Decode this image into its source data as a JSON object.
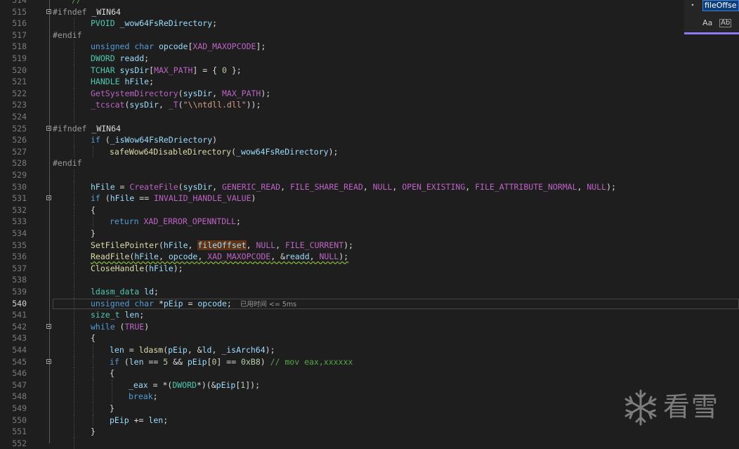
{
  "find_widget": {
    "search_value": "fileOffse",
    "toggle_icon": "chevron-right-icon",
    "match_case_label": "Aa",
    "whole_word_label": "Ab"
  },
  "watermark": {
    "icon": "snowflake-icon",
    "text": "看雪"
  },
  "editor": {
    "current_line": 540,
    "lines": [
      {
        "n": "514",
        "indent": 1,
        "fold": false,
        "tokens": [
          {
            "t": "//",
            "c": "cm"
          }
        ]
      },
      {
        "n": "515",
        "indent": 0,
        "fold": true,
        "tokens": [
          {
            "t": "#ifndef ",
            "c": "pp"
          },
          {
            "t": "_WIN64",
            "c": "plain"
          }
        ]
      },
      {
        "n": "516",
        "indent": 2,
        "fold": false,
        "tokens": [
          {
            "t": "PVOID ",
            "c": "ty"
          },
          {
            "t": "_wow64FsReDirectory",
            "c": "var"
          },
          {
            "t": ";",
            "c": "plain"
          }
        ]
      },
      {
        "n": "517",
        "indent": 0,
        "fold": false,
        "tokens": [
          {
            "t": "#endif",
            "c": "pp"
          }
        ]
      },
      {
        "n": "518",
        "indent": 2,
        "fold": false,
        "tokens": [
          {
            "t": "unsigned ",
            "c": "kw"
          },
          {
            "t": "char ",
            "c": "kw"
          },
          {
            "t": "opcode",
            "c": "var"
          },
          {
            "t": "[",
            "c": "plain"
          },
          {
            "t": "XAD_MAXOPCODE",
            "c": "mac"
          },
          {
            "t": "];",
            "c": "plain"
          }
        ]
      },
      {
        "n": "519",
        "indent": 2,
        "fold": false,
        "tokens": [
          {
            "t": "DWORD ",
            "c": "ty"
          },
          {
            "t": "readd",
            "c": "var"
          },
          {
            "t": ";",
            "c": "plain"
          }
        ]
      },
      {
        "n": "520",
        "indent": 2,
        "fold": false,
        "tokens": [
          {
            "t": "TCHAR ",
            "c": "ty"
          },
          {
            "t": "sysDir",
            "c": "var"
          },
          {
            "t": "[",
            "c": "plain"
          },
          {
            "t": "MAX_PATH",
            "c": "mac"
          },
          {
            "t": "] = { ",
            "c": "plain"
          },
          {
            "t": "0",
            "c": "num"
          },
          {
            "t": " };",
            "c": "plain"
          }
        ]
      },
      {
        "n": "521",
        "indent": 2,
        "fold": false,
        "tokens": [
          {
            "t": "HANDLE ",
            "c": "ty"
          },
          {
            "t": "hFile",
            "c": "var"
          },
          {
            "t": ";",
            "c": "plain"
          }
        ]
      },
      {
        "n": "522",
        "indent": 2,
        "fold": false,
        "tokens": [
          {
            "t": "GetSystemDirectory",
            "c": "mac"
          },
          {
            "t": "(",
            "c": "plain"
          },
          {
            "t": "sysDir",
            "c": "var"
          },
          {
            "t": ", ",
            "c": "plain"
          },
          {
            "t": "MAX_PATH",
            "c": "mac"
          },
          {
            "t": ");",
            "c": "plain"
          }
        ]
      },
      {
        "n": "523",
        "indent": 2,
        "fold": false,
        "tokens": [
          {
            "t": "_tcscat",
            "c": "mac"
          },
          {
            "t": "(",
            "c": "plain"
          },
          {
            "t": "sysDir",
            "c": "var"
          },
          {
            "t": ", ",
            "c": "plain"
          },
          {
            "t": "_T",
            "c": "mac"
          },
          {
            "t": "(",
            "c": "plain"
          },
          {
            "t": "\"\\\\ntdll.dll\"",
            "c": "str"
          },
          {
            "t": "));",
            "c": "plain"
          }
        ]
      },
      {
        "n": "524",
        "indent": 2,
        "fold": false,
        "tokens": []
      },
      {
        "n": "525",
        "indent": 0,
        "fold": true,
        "tokens": [
          {
            "t": "#ifndef ",
            "c": "pp"
          },
          {
            "t": "_WIN64",
            "c": "plain"
          }
        ]
      },
      {
        "n": "526",
        "indent": 2,
        "fold": false,
        "tokens": [
          {
            "t": "if ",
            "c": "kw"
          },
          {
            "t": "(",
            "c": "plain"
          },
          {
            "t": "_isWow64FsReDriectory",
            "c": "var"
          },
          {
            "t": ")",
            "c": "plain"
          }
        ]
      },
      {
        "n": "527",
        "indent": 3,
        "fold": false,
        "tokens": [
          {
            "t": "safeWow64DisableDirectory",
            "c": "fn"
          },
          {
            "t": "(",
            "c": "plain"
          },
          {
            "t": "_wow64FsReDirectory",
            "c": "var"
          },
          {
            "t": ");",
            "c": "plain"
          }
        ]
      },
      {
        "n": "528",
        "indent": 0,
        "fold": false,
        "tokens": [
          {
            "t": "#endif",
            "c": "pp"
          }
        ]
      },
      {
        "n": "529",
        "indent": 2,
        "fold": false,
        "tokens": []
      },
      {
        "n": "530",
        "indent": 2,
        "fold": false,
        "tokens": [
          {
            "t": "hFile",
            "c": "var"
          },
          {
            "t": " = ",
            "c": "plain"
          },
          {
            "t": "CreateFile",
            "c": "mac"
          },
          {
            "t": "(",
            "c": "plain"
          },
          {
            "t": "sysDir",
            "c": "var"
          },
          {
            "t": ", ",
            "c": "plain"
          },
          {
            "t": "GENERIC_READ",
            "c": "mac"
          },
          {
            "t": ", ",
            "c": "plain"
          },
          {
            "t": "FILE_SHARE_READ",
            "c": "mac"
          },
          {
            "t": ", ",
            "c": "plain"
          },
          {
            "t": "NULL",
            "c": "mac"
          },
          {
            "t": ", ",
            "c": "plain"
          },
          {
            "t": "OPEN_EXISTING",
            "c": "mac"
          },
          {
            "t": ", ",
            "c": "plain"
          },
          {
            "t": "FILE_ATTRIBUTE_NORMAL",
            "c": "mac"
          },
          {
            "t": ", ",
            "c": "plain"
          },
          {
            "t": "NULL",
            "c": "mac"
          },
          {
            "t": ");",
            "c": "plain"
          }
        ]
      },
      {
        "n": "531",
        "indent": 2,
        "fold": true,
        "tokens": [
          {
            "t": "if ",
            "c": "kw"
          },
          {
            "t": "(",
            "c": "plain"
          },
          {
            "t": "hFile",
            "c": "var"
          },
          {
            "t": " == ",
            "c": "plain"
          },
          {
            "t": "INVALID_HANDLE_VALUE",
            "c": "mac"
          },
          {
            "t": ")",
            "c": "plain"
          }
        ]
      },
      {
        "n": "532",
        "indent": 2,
        "fold": false,
        "tokens": [
          {
            "t": "{",
            "c": "plain"
          }
        ]
      },
      {
        "n": "533",
        "indent": 3,
        "fold": false,
        "tokens": [
          {
            "t": "return ",
            "c": "kw"
          },
          {
            "t": "XAD_ERROR_OPENNTDLL",
            "c": "mac"
          },
          {
            "t": ";",
            "c": "plain"
          }
        ]
      },
      {
        "n": "534",
        "indent": 2,
        "fold": false,
        "tokens": [
          {
            "t": "}",
            "c": "plain"
          }
        ]
      },
      {
        "n": "535",
        "indent": 2,
        "fold": false,
        "tokens": [
          {
            "t": "SetFilePointer",
            "c": "fn"
          },
          {
            "t": "(",
            "c": "plain"
          },
          {
            "t": "hFile",
            "c": "var"
          },
          {
            "t": ", ",
            "c": "plain"
          },
          {
            "t": "fileOffset",
            "c": "var",
            "hl": true
          },
          {
            "t": ", ",
            "c": "plain"
          },
          {
            "t": "NULL",
            "c": "mac"
          },
          {
            "t": ", ",
            "c": "plain"
          },
          {
            "t": "FILE_CURRENT",
            "c": "mac"
          },
          {
            "t": ");",
            "c": "plain"
          }
        ]
      },
      {
        "n": "536",
        "indent": 2,
        "fold": false,
        "squig": true,
        "tokens": [
          {
            "t": "ReadFile",
            "c": "fn"
          },
          {
            "t": "(",
            "c": "plain"
          },
          {
            "t": "hFile",
            "c": "var"
          },
          {
            "t": ", ",
            "c": "plain"
          },
          {
            "t": "opcode",
            "c": "var"
          },
          {
            "t": ", ",
            "c": "plain"
          },
          {
            "t": "XAD_MAXOPCODE",
            "c": "mac"
          },
          {
            "t": ", &",
            "c": "plain"
          },
          {
            "t": "readd",
            "c": "var"
          },
          {
            "t": ", ",
            "c": "plain"
          },
          {
            "t": "NULL",
            "c": "mac"
          },
          {
            "t": ");",
            "c": "plain"
          }
        ]
      },
      {
        "n": "537",
        "indent": 2,
        "fold": false,
        "tokens": [
          {
            "t": "CloseHandle",
            "c": "fn"
          },
          {
            "t": "(",
            "c": "plain"
          },
          {
            "t": "hFile",
            "c": "var"
          },
          {
            "t": ");",
            "c": "plain"
          }
        ]
      },
      {
        "n": "538",
        "indent": 2,
        "fold": false,
        "tokens": []
      },
      {
        "n": "539",
        "indent": 2,
        "fold": false,
        "tokens": [
          {
            "t": "ldasm_data ",
            "c": "ty"
          },
          {
            "t": "ld",
            "c": "var"
          },
          {
            "t": ";",
            "c": "plain"
          }
        ]
      },
      {
        "n": "540",
        "indent": 2,
        "fold": false,
        "elapsed": "已用时间 <= 5ms",
        "tokens": [
          {
            "t": "unsigned ",
            "c": "kw"
          },
          {
            "t": "char ",
            "c": "kw"
          },
          {
            "t": "*",
            "c": "plain"
          },
          {
            "t": "pEip",
            "c": "var"
          },
          {
            "t": " = ",
            "c": "plain"
          },
          {
            "t": "opcode",
            "c": "var"
          },
          {
            "t": ";",
            "c": "plain"
          }
        ]
      },
      {
        "n": "541",
        "indent": 2,
        "fold": false,
        "tokens": [
          {
            "t": "size_t ",
            "c": "ty"
          },
          {
            "t": "len",
            "c": "var"
          },
          {
            "t": ";",
            "c": "plain"
          }
        ]
      },
      {
        "n": "542",
        "indent": 2,
        "fold": true,
        "tokens": [
          {
            "t": "while ",
            "c": "kw"
          },
          {
            "t": "(",
            "c": "plain"
          },
          {
            "t": "TRUE",
            "c": "mac"
          },
          {
            "t": ")",
            "c": "plain"
          }
        ]
      },
      {
        "n": "543",
        "indent": 2,
        "fold": false,
        "tokens": [
          {
            "t": "{",
            "c": "plain"
          }
        ]
      },
      {
        "n": "544",
        "indent": 3,
        "fold": false,
        "tokens": [
          {
            "t": "len",
            "c": "var"
          },
          {
            "t": " = ",
            "c": "plain"
          },
          {
            "t": "ldasm",
            "c": "fn"
          },
          {
            "t": "(",
            "c": "plain"
          },
          {
            "t": "pEip",
            "c": "var"
          },
          {
            "t": ", &",
            "c": "plain"
          },
          {
            "t": "ld",
            "c": "var"
          },
          {
            "t": ", ",
            "c": "plain"
          },
          {
            "t": "_isArch64",
            "c": "var"
          },
          {
            "t": ");",
            "c": "plain"
          }
        ]
      },
      {
        "n": "545",
        "indent": 3,
        "fold": true,
        "tokens": [
          {
            "t": "if ",
            "c": "kw"
          },
          {
            "t": "(",
            "c": "plain"
          },
          {
            "t": "len",
            "c": "var"
          },
          {
            "t": " == ",
            "c": "plain"
          },
          {
            "t": "5",
            "c": "num"
          },
          {
            "t": " && ",
            "c": "plain"
          },
          {
            "t": "pEip",
            "c": "var"
          },
          {
            "t": "[",
            "c": "plain"
          },
          {
            "t": "0",
            "c": "num"
          },
          {
            "t": "] == ",
            "c": "plain"
          },
          {
            "t": "0xB8",
            "c": "num"
          },
          {
            "t": ") ",
            "c": "plain"
          },
          {
            "t": "// mov eax,xxxxxx",
            "c": "cm"
          }
        ]
      },
      {
        "n": "546",
        "indent": 3,
        "fold": false,
        "tokens": [
          {
            "t": "{",
            "c": "plain"
          }
        ]
      },
      {
        "n": "547",
        "indent": 4,
        "fold": false,
        "tokens": [
          {
            "t": "_eax",
            "c": "var"
          },
          {
            "t": " = *(",
            "c": "plain"
          },
          {
            "t": "DWORD",
            "c": "ty"
          },
          {
            "t": "*)(&",
            "c": "plain"
          },
          {
            "t": "pEip",
            "c": "var"
          },
          {
            "t": "[",
            "c": "plain"
          },
          {
            "t": "1",
            "c": "num"
          },
          {
            "t": "]);",
            "c": "plain"
          }
        ]
      },
      {
        "n": "548",
        "indent": 4,
        "fold": false,
        "tokens": [
          {
            "t": "break",
            "c": "kw"
          },
          {
            "t": ";",
            "c": "plain"
          }
        ]
      },
      {
        "n": "549",
        "indent": 3,
        "fold": false,
        "tokens": [
          {
            "t": "}",
            "c": "plain"
          }
        ]
      },
      {
        "n": "550",
        "indent": 3,
        "fold": false,
        "tokens": [
          {
            "t": "pEip",
            "c": "var"
          },
          {
            "t": " += ",
            "c": "plain"
          },
          {
            "t": "len",
            "c": "var"
          },
          {
            "t": ";",
            "c": "plain"
          }
        ]
      },
      {
        "n": "551",
        "indent": 2,
        "fold": false,
        "tokens": [
          {
            "t": "}",
            "c": "plain"
          }
        ]
      },
      {
        "n": "552",
        "indent": 2,
        "fold": false,
        "tokens": []
      }
    ]
  }
}
